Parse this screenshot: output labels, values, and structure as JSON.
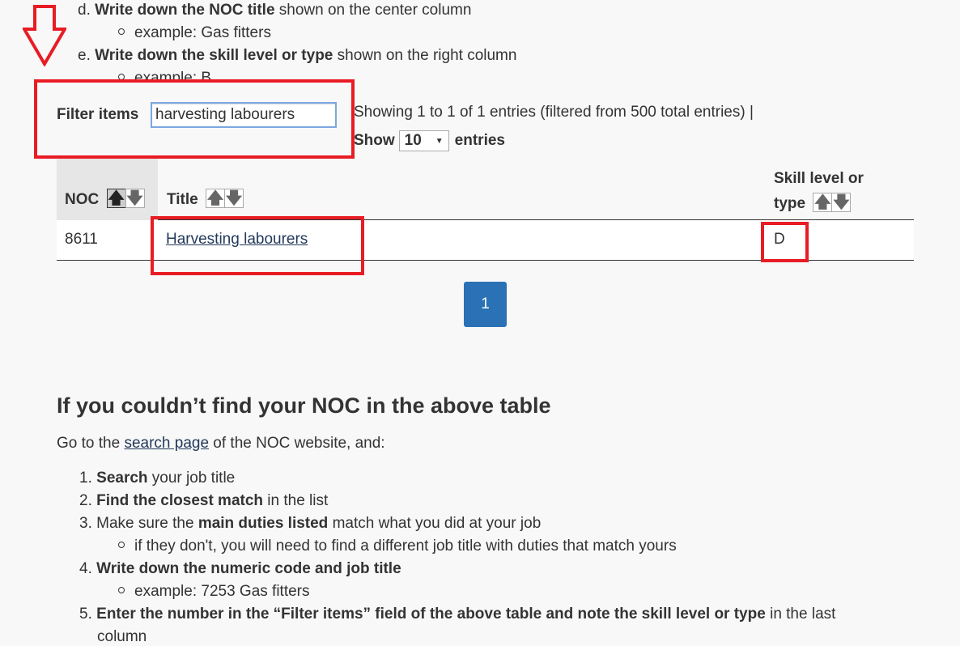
{
  "instructions_top": {
    "d": {
      "marker": "d.",
      "bold": "Write down the NOC title",
      "rest": " shown on the center column",
      "sub": "example: Gas fitters"
    },
    "e": {
      "marker": "e.",
      "bold": "Write down the skill level or type",
      "rest": " shown on the right column",
      "sub": "example: B"
    }
  },
  "filter": {
    "label": "Filter items",
    "value": "harvesting labourers",
    "showing_text": "Showing 1 to 1 of 1 entries (filtered from 500 total entries) |",
    "show_label": "Show",
    "page_size": "10",
    "entries_label": "entries"
  },
  "table": {
    "columns": [
      {
        "label": "NOC",
        "sort_active": "asc"
      },
      {
        "label": "Title",
        "sort_active": null
      },
      {
        "label_line1": "Skill level or",
        "label_line2": "type",
        "sort_active": null
      }
    ],
    "sort_icons": {
      "up": "arrow-up-icon",
      "down": "arrow-down-icon"
    },
    "rows": [
      {
        "noc": "8611",
        "title": "Harvesting labourers",
        "skill": "D"
      }
    ]
  },
  "pagination": {
    "current_page": "1"
  },
  "fallback": {
    "heading": "If you couldn’t find your NOC in the above table",
    "intro_prefix": "Go to the ",
    "intro_link": "search page",
    "intro_suffix": " of the NOC website, and:",
    "steps": [
      {
        "num": "1.",
        "bold": "Search",
        "rest": " your job title"
      },
      {
        "num": "2.",
        "bold": "Find the closest match",
        "rest": " in the list"
      },
      {
        "num": "3.",
        "pre": "Make sure the ",
        "bold": "main duties listed",
        "rest": " match what you did at your job",
        "sub": "if they don't, you will need to find a different job title with duties that match yours"
      },
      {
        "num": "4.",
        "bold": "Write down the numeric code and job title",
        "sub": "example: 7253 Gas fitters"
      },
      {
        "num": "5.",
        "bold": "Enter the number in the “Filter items” field of the above table and note the skill level or type",
        "rest": " in the last",
        "rest_line2": "column"
      }
    ]
  },
  "annotation_color": "#e81c24",
  "accent_color": "#2a72b5"
}
